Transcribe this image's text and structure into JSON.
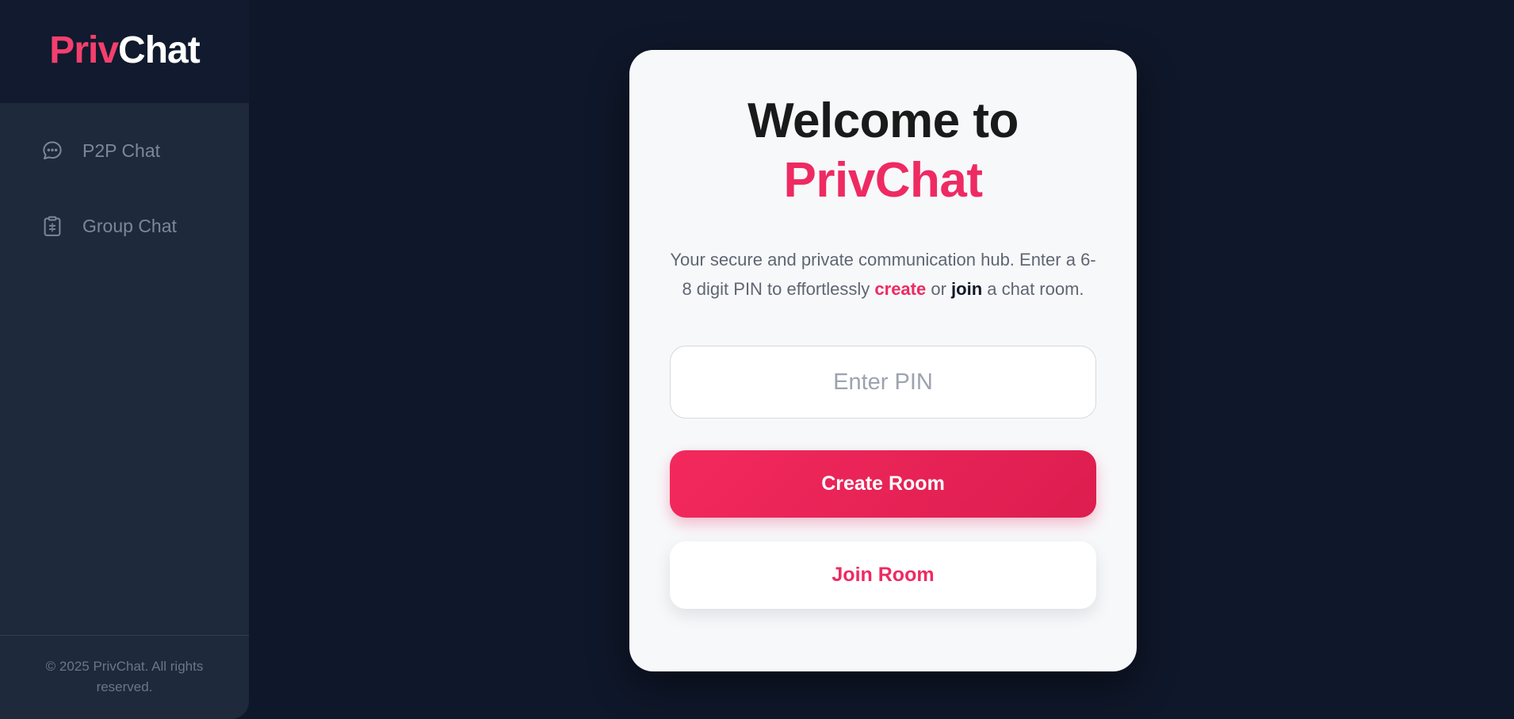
{
  "brand": {
    "priv": "Priv",
    "chat": "Chat"
  },
  "sidebar": {
    "items": [
      {
        "label": "P2P Chat",
        "icon": "chat-bubble-icon"
      },
      {
        "label": "Group Chat",
        "icon": "group-clipboard-icon"
      }
    ],
    "footer": "© 2025 PrivChat. All rights reserved."
  },
  "card": {
    "title_line1": "Welcome to",
    "title_line2": "PrivChat",
    "desc_part1": "Your secure and private communication hub. Enter a 6-8 digit PIN to effortlessly ",
    "desc_create": "create",
    "desc_or": " or ",
    "desc_join": "join",
    "desc_part2": " a chat room.",
    "pin_placeholder": "Enter PIN",
    "pin_value": "",
    "create_label": "Create Room",
    "join_label": "Join Room"
  },
  "colors": {
    "accent": "#ee2a62",
    "background": "#0f172a",
    "sidebar": "#1e293b",
    "card": "#f7f8fa"
  }
}
